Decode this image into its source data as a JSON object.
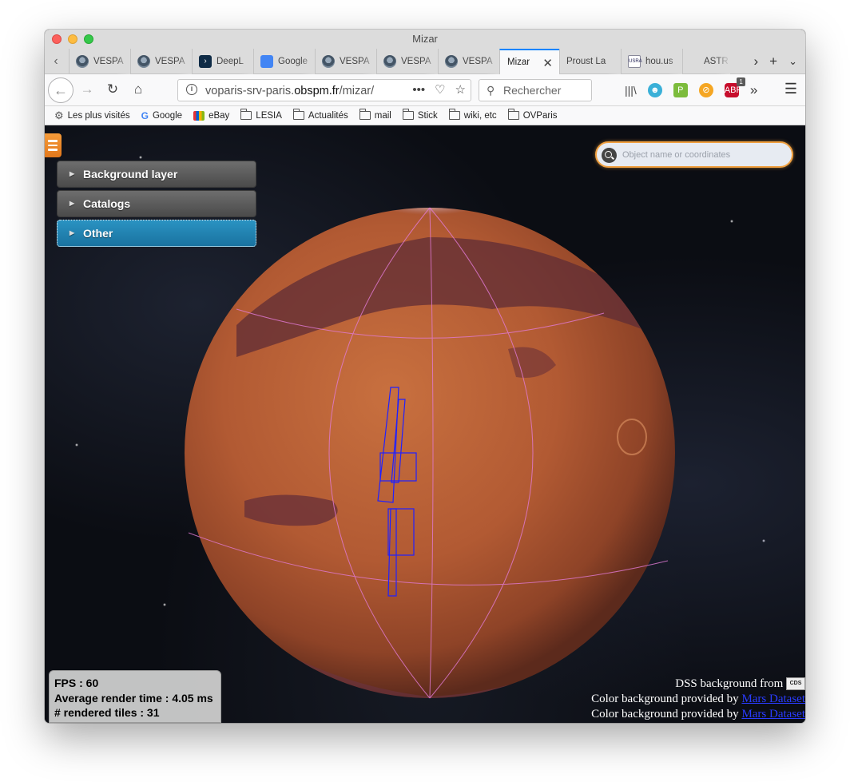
{
  "window": {
    "title": "Mizar"
  },
  "tabs": [
    {
      "label": "VESPA",
      "icon": "vespa-icon"
    },
    {
      "label": "VESPA",
      "icon": "vespa-icon"
    },
    {
      "label": "DeepL",
      "icon": "deepl-icon"
    },
    {
      "label": "Google",
      "icon": "google-translate-icon"
    },
    {
      "label": "VESPA",
      "icon": "vespa-icon"
    },
    {
      "label": "VESPA",
      "icon": "vespa-icon"
    },
    {
      "label": "VESPA",
      "icon": "vespa-icon"
    },
    {
      "label": "Mizar",
      "icon": "none",
      "active": true
    },
    {
      "label": "Proust La",
      "icon": "none"
    },
    {
      "label": "hou.us",
      "icon": "usra-icon"
    },
    {
      "label": "ASTR",
      "icon": "none"
    }
  ],
  "navbar": {
    "url_prefix": "voparis-srv-paris.",
    "url_domain": "obspm.fr",
    "url_suffix": "/mizar/",
    "search_placeholder": "Rechercher",
    "abp_badge": "1"
  },
  "bookmarks": [
    {
      "label": "Les plus visités",
      "icon": "gear-icon"
    },
    {
      "label": "Google",
      "icon": "google-icon"
    },
    {
      "label": "eBay",
      "icon": "ebay-icon"
    },
    {
      "label": "LESIA",
      "icon": "folder-icon"
    },
    {
      "label": "Actualités",
      "icon": "folder-icon"
    },
    {
      "label": "mail",
      "icon": "folder-icon"
    },
    {
      "label": "Stick",
      "icon": "folder-icon"
    },
    {
      "label": "wiki, etc",
      "icon": "folder-icon"
    },
    {
      "label": "OVParis",
      "icon": "folder-icon"
    }
  ],
  "mizar": {
    "panels": [
      {
        "label": "Background layer",
        "active": false
      },
      {
        "label": "Catalogs",
        "active": false
      },
      {
        "label": "Other",
        "active": true
      }
    ],
    "object_search_placeholder": "Object name or coordinates",
    "stats": {
      "fps": "FPS : 60",
      "render_time": "Average render time : 4.05 ms",
      "tiles": "# rendered tiles : 31"
    },
    "credits": {
      "dss_text": "DSS background from",
      "cds_logo": "CDS",
      "color_text": "Color background provided by",
      "mars_link": "Mars Dataset"
    },
    "colors": {
      "accent_orange": "#f0a040",
      "active_panel": "#2186b6",
      "footprint_blue": "#2020ff",
      "grid_pink": "#e27ad6",
      "mars_surface": "#b85e36"
    }
  }
}
